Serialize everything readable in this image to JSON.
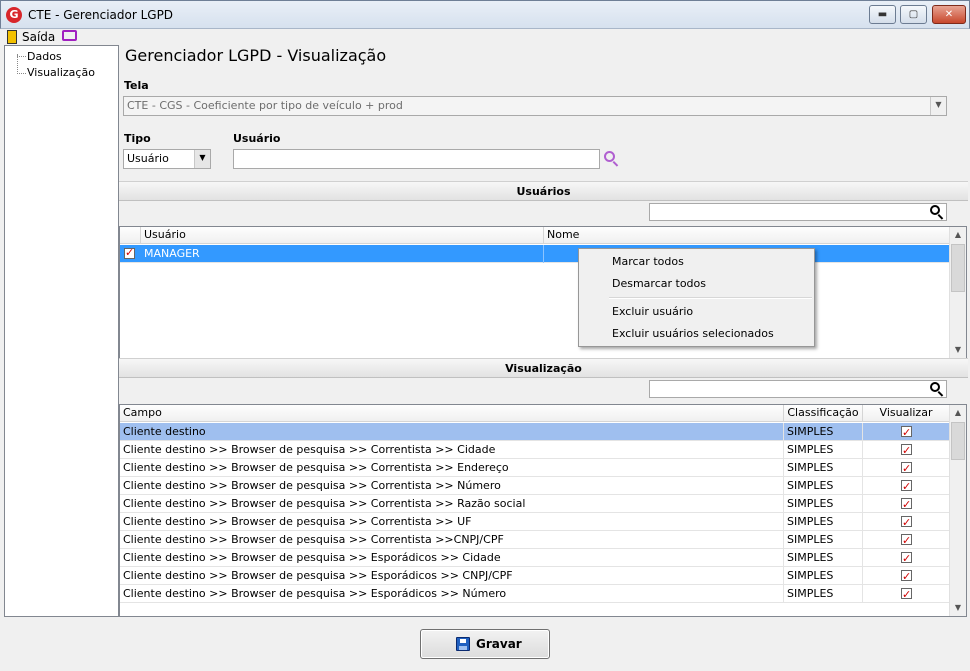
{
  "window": {
    "title": "CTE - Gerenciador LGPD",
    "app_icon_letter": "G",
    "minimize": "▬",
    "maximize": "▢",
    "close": "✕"
  },
  "menubar": {
    "exit_label": "Saída",
    "exit_icon": "exit-door-icon",
    "screen_icon": "monitor-icon"
  },
  "tree": {
    "items": [
      "Dados",
      "Visualização"
    ]
  },
  "page": {
    "title": "Gerenciador LGPD - Visualização"
  },
  "form": {
    "tela_label": "Tela",
    "tela_value": "CTE - CGS - Coeficiente por tipo de veículo + prod",
    "tipo_label": "Tipo",
    "tipo_value": "Usuário",
    "usuario_label": "Usuário",
    "usuario_value": ""
  },
  "users_section": {
    "title": "Usuários",
    "filter_value": "",
    "columns": [
      "Usuário",
      "Nome"
    ],
    "rows": [
      {
        "checked": true,
        "usuario": "MANAGER",
        "nome": ""
      }
    ]
  },
  "context_menu": {
    "items": [
      "Marcar todos",
      "Desmarcar todos",
      "Excluir usuário",
      "Excluir usuários selecionados"
    ]
  },
  "view_section": {
    "title": "Visualização",
    "filter_value": "",
    "columns": [
      "Campo",
      "Classificação",
      "Visualizar"
    ],
    "rows": [
      {
        "campo": "Cliente destino",
        "classificacao": "SIMPLES",
        "visualizar": true
      },
      {
        "campo": "Cliente destino >> Browser de pesquisa >> Correntista >> Cidade",
        "classificacao": "SIMPLES",
        "visualizar": true
      },
      {
        "campo": "Cliente destino >> Browser de pesquisa >> Correntista >> Endereço",
        "classificacao": "SIMPLES",
        "visualizar": true
      },
      {
        "campo": "Cliente destino >> Browser de pesquisa >> Correntista >> Número",
        "classificacao": "SIMPLES",
        "visualizar": true
      },
      {
        "campo": "Cliente destino >> Browser de pesquisa >> Correntista >> Razão social",
        "classificacao": "SIMPLES",
        "visualizar": true
      },
      {
        "campo": "Cliente destino >> Browser de pesquisa >> Correntista >> UF",
        "classificacao": "SIMPLES",
        "visualizar": true
      },
      {
        "campo": "Cliente destino >> Browser de pesquisa >> Correntista >>CNPJ/CPF",
        "classificacao": "SIMPLES",
        "visualizar": true
      },
      {
        "campo": "Cliente destino >> Browser de pesquisa >> Esporádicos >> Cidade",
        "classificacao": "SIMPLES",
        "visualizar": true
      },
      {
        "campo": "Cliente destino >> Browser de pesquisa >> Esporádicos >> CNPJ/CPF",
        "classificacao": "SIMPLES",
        "visualizar": true
      },
      {
        "campo": "Cliente destino >> Browser de pesquisa >> Esporádicos >> Número",
        "classificacao": "SIMPLES",
        "visualizar": true
      }
    ]
  },
  "footer": {
    "save_label": "Gravar"
  },
  "colors": {
    "selection_blue": "#3399ff",
    "selection_light": "#9fbfef",
    "search_accent": "#b05fd0",
    "check_red": "#d00000"
  }
}
